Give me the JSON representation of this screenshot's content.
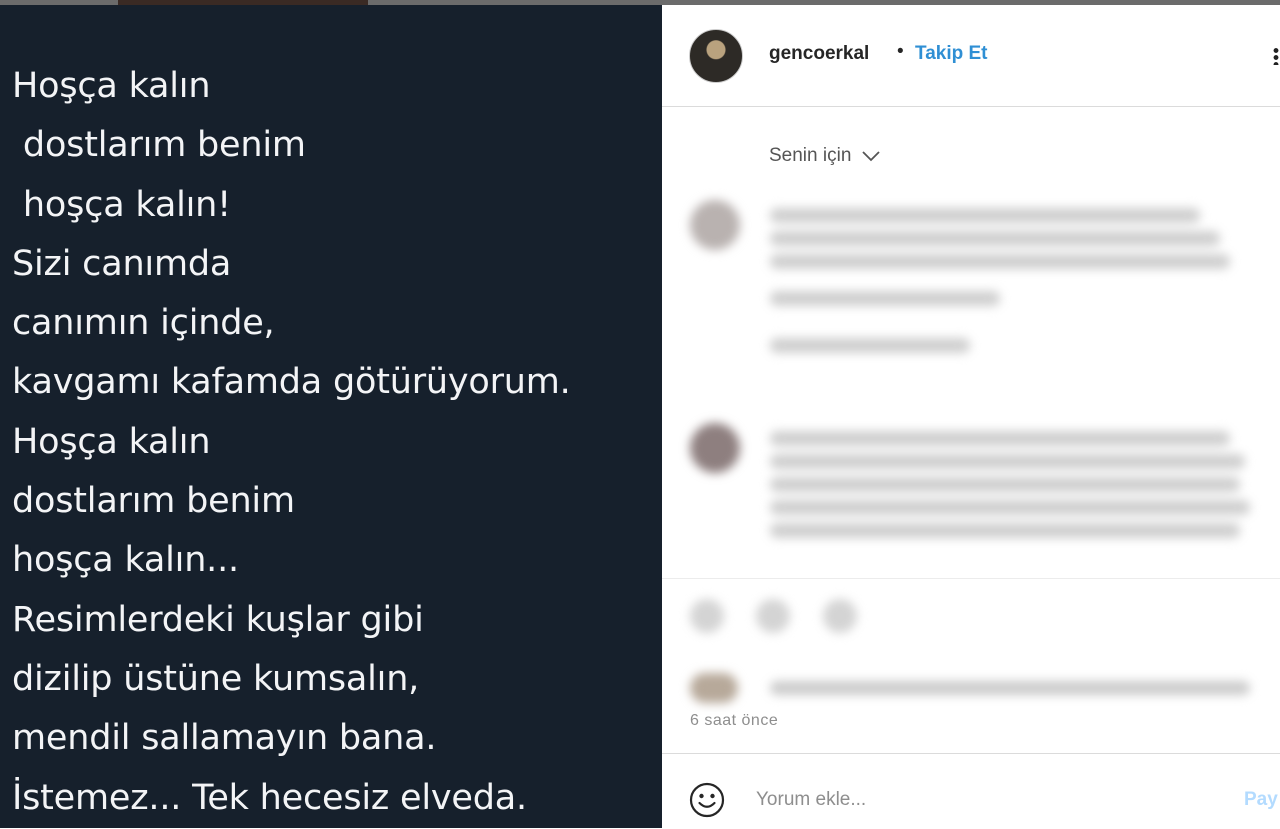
{
  "poem": {
    "lines": [
      "Hoşça kalın",
      " dostlarım benim",
      " hoşça kalın!",
      "Sizi canımda",
      "canımın içinde,",
      "kavgamı kafamda götürüyorum.",
      "Hoşça kalın",
      "dostlarım benim",
      "hoşça kalın...",
      "Resimlerdeki kuşlar gibi",
      "dizilip üstüne kumsalın,",
      "mendil sallamayın bana.",
      "İstemez... Tek hecesiz elveda."
    ]
  },
  "header": {
    "username": "gencoerkal",
    "separator": "•",
    "follow_label": "Takip Et"
  },
  "comments": {
    "filter_label": "Senin için"
  },
  "post": {
    "timestamp": "6 saat önce"
  },
  "comment_box": {
    "placeholder": "Yorum ekle...",
    "share_label": "Pay"
  },
  "colors": {
    "post_background": "#16202c",
    "poem_text": "#f3f4f6",
    "follow_blue": "#2f8fd4",
    "share_disabled": "#b3dbff"
  }
}
